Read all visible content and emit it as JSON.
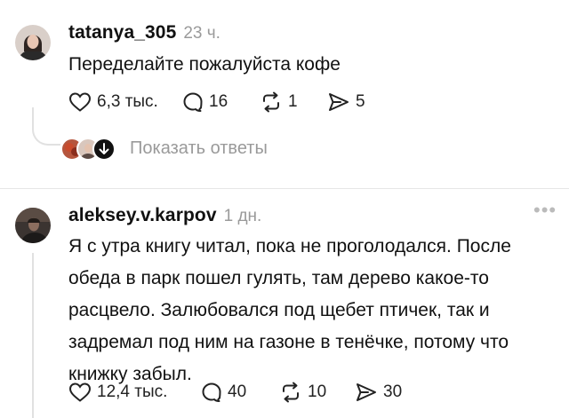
{
  "comments": [
    {
      "username": "tatanya_305",
      "time": "23 ч.",
      "text": "Переделайте пожалуйста кофе",
      "likes": "6,3 тыс.",
      "replies": "16",
      "reposts": "1",
      "shares": "5",
      "show_replies_label": "Показать ответы"
    },
    {
      "username": "aleksey.v.karpov",
      "time": "1 дн.",
      "text": "Я с утра книгу читал, пока не проголодался. После\nобеда в парк пошел гулять, там дерево какое-то\nрасцвело. Залюбовался под щебет птичек, так и\nзадремал под ним на газоне в тенёчке, потому что\nкнижку забыл.",
      "likes": "12,4 тыс.",
      "replies": "40",
      "reposts": "10",
      "shares": "30"
    }
  ],
  "icons": {
    "like": "heart-icon",
    "reply": "speech-bubble-icon",
    "repost": "repost-arrows-icon",
    "share": "send-arrow-icon",
    "more": "more-dots-icon",
    "expand": "arrow-down-icon"
  },
  "colors": {
    "text": "#111111",
    "muted": "#9a9a9a",
    "divider": "#e6e6e6"
  }
}
